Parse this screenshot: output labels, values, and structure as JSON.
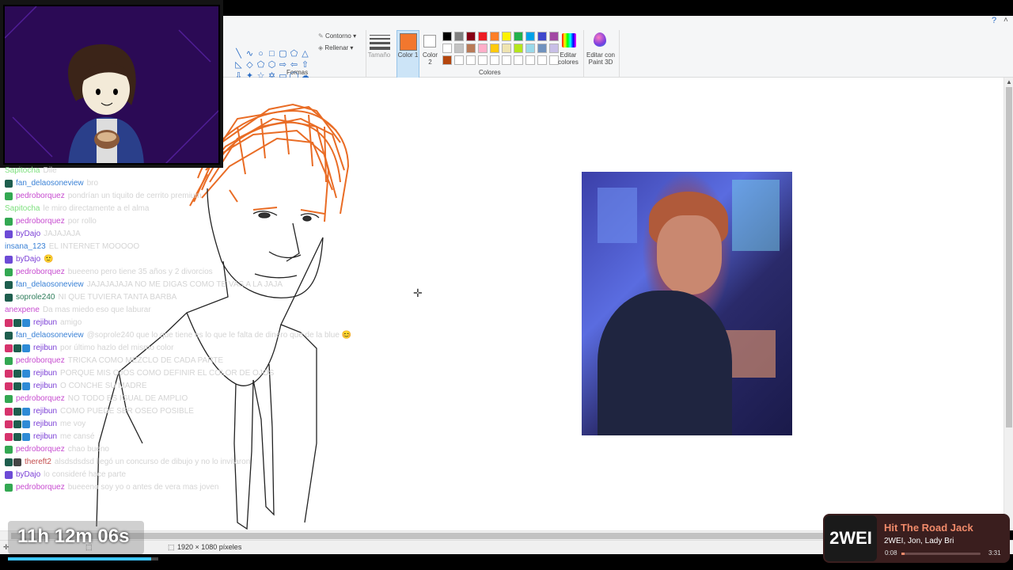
{
  "ribbon": {
    "contour_label": "Contorno",
    "fill_label": "Rellenar",
    "shapes_group": "Formas",
    "size_label": "Tamaño",
    "color1_label": "Color 1",
    "color2_label": "Color 2",
    "colors_group": "Colores",
    "edit_colors_label": "Editar colores",
    "edit_paint3d_label": "Editar con Paint 3D",
    "color1": "#f2772e",
    "color2": "#ffffff",
    "palette_row1": [
      "#000000",
      "#7f7f7f",
      "#880015",
      "#ed1c24",
      "#ff7f27",
      "#fff200",
      "#22b14c",
      "#00a2e8",
      "#3f48cc",
      "#a349a4"
    ],
    "palette_row2": [
      "#ffffff",
      "#c3c3c3",
      "#b97a57",
      "#ffaec9",
      "#ffc90e",
      "#efe4b0",
      "#b5e61d",
      "#99d9ea",
      "#7092be",
      "#c8bfe7"
    ],
    "palette_row3": [
      "#b5460e",
      "#ffffff",
      "#ffffff",
      "#ffffff",
      "#ffffff",
      "#ffffff",
      "#ffffff",
      "#ffffff",
      "#ffffff",
      "#ffffff"
    ]
  },
  "status": {
    "dimensions": "1920 × 1080 píxeles"
  },
  "chat": [
    {
      "user": "Sapitocha",
      "color": "#7fe07f",
      "badges": [],
      "msg": "Dile"
    },
    {
      "user": "fan_delaosoneview",
      "color": "#3b82d6",
      "badges": [
        "#1e5e4e"
      ],
      "msg": "bro"
    },
    {
      "user": "pedroborquez",
      "color": "#c74cd0",
      "badges": [
        "#33a852"
      ],
      "msg": "pondrían un tiquito de cerrito premium"
    },
    {
      "user": "Sapitocha",
      "color": "#7fe07f",
      "badges": [],
      "msg": "le miro directamente a el alma"
    },
    {
      "user": "pedroborquez",
      "color": "#c74cd0",
      "badges": [
        "#33a852"
      ],
      "msg": "por rollo"
    },
    {
      "user": "byDajo",
      "color": "#7b3fd6",
      "badges": [
        "#6d4bd6"
      ],
      "msg": "JAJAJAJA"
    },
    {
      "user": "insana_123",
      "color": "#3b82d6",
      "badges": [],
      "msg": "EL INTERNET MOOOOO"
    },
    {
      "user": "byDajo",
      "color": "#7b3fd6",
      "badges": [
        "#6d4bd6"
      ],
      "msg": "🙂"
    },
    {
      "user": "pedroborquez",
      "color": "#c74cd0",
      "badges": [
        "#33a852"
      ],
      "msg": "bueeeno pero tiene 35 años y 2 divorcios"
    },
    {
      "user": "fan_delaosoneview",
      "color": "#3b82d6",
      "badges": [
        "#1e5e4e"
      ],
      "msg": "JAJAJAJAJA NO ME DIGAS COMO TE VAS A LA JAJA"
    },
    {
      "user": "soprole240",
      "color": "#2e7d5b",
      "badges": [
        "#1e5e4e"
      ],
      "msg": "NI QUE TUVIERA TANTA BARBA"
    },
    {
      "user": "anexpene",
      "color": "#c74cd0",
      "badges": [],
      "msg": "Da mas miedo eso que laburar"
    },
    {
      "user": "rejibun",
      "color": "#7b3fd6",
      "badges": [
        "#d6336c",
        "#1e5e4e",
        "#2e8bd6"
      ],
      "msg": "amigo"
    },
    {
      "user": "fan_delaosoneview",
      "color": "#3b82d6",
      "badges": [
        "#1e5e4e"
      ],
      "msg": "@soprole240 que lo que tiene es lo que le falta de dinero que de la blue 😊"
    },
    {
      "user": "rejibun",
      "color": "#7b3fd6",
      "badges": [
        "#d6336c",
        "#1e5e4e",
        "#2e8bd6"
      ],
      "msg": "por último hazlo del mismo color"
    },
    {
      "user": "pedroborquez",
      "color": "#c74cd0",
      "badges": [
        "#33a852"
      ],
      "msg": "TRICKA COMO MEZCLO DE CADA PARTE"
    },
    {
      "user": "rejibun",
      "color": "#7b3fd6",
      "badges": [
        "#d6336c",
        "#1e5e4e",
        "#2e8bd6"
      ],
      "msg": "PORQUE MIS OJOS COMO DEFINIR EL COLOR DE OJOS"
    },
    {
      "user": "rejibun",
      "color": "#7b3fd6",
      "badges": [
        "#d6336c",
        "#1e5e4e",
        "#2e8bd6"
      ],
      "msg": "O CONCHE SU MADRE"
    },
    {
      "user": "pedroborquez",
      "color": "#c74cd0",
      "badges": [
        "#33a852"
      ],
      "msg": "NO TODO ES IGUAL DE AMPLIO"
    },
    {
      "user": "rejibun",
      "color": "#7b3fd6",
      "badges": [
        "#d6336c",
        "#1e5e4e",
        "#2e8bd6"
      ],
      "msg": "COMO PUEDE SER OSEO POSIBLE"
    },
    {
      "user": "rejibun",
      "color": "#7b3fd6",
      "badges": [
        "#d6336c",
        "#1e5e4e",
        "#2e8bd6"
      ],
      "msg": "me voy"
    },
    {
      "user": "rejibun",
      "color": "#7b3fd6",
      "badges": [
        "#d6336c",
        "#1e5e4e",
        "#2e8bd6"
      ],
      "msg": "me cansé"
    },
    {
      "user": "pedroborquez",
      "color": "#c74cd0",
      "badges": [
        "#33a852"
      ],
      "msg": "chao bueno"
    },
    {
      "user": "thereft2",
      "color": "#c44d4d",
      "badges": [
        "#1e5e4e",
        "#444444"
      ],
      "msg": "alsdsdsdsd llegó un concurso de dibujo y no lo invitaron"
    },
    {
      "user": "byDajo",
      "color": "#7b3fd6",
      "badges": [
        "#6d4bd6"
      ],
      "msg": "lo consideré hace parte"
    },
    {
      "user": "pedroborquez",
      "color": "#c74cd0",
      "badges": [
        "#33a852"
      ],
      "msg": "bueeeno soy yo o antes de vera mas joven"
    }
  ],
  "timer": {
    "text": "11h 12m 06s",
    "progress": 0.95
  },
  "music": {
    "cover_text": "2WEI",
    "title": "Hit The Road Jack",
    "artist": "2WEI, Jon, Lady Bri",
    "elapsed": "0:08",
    "total": "3:31",
    "progress": 0.04
  }
}
